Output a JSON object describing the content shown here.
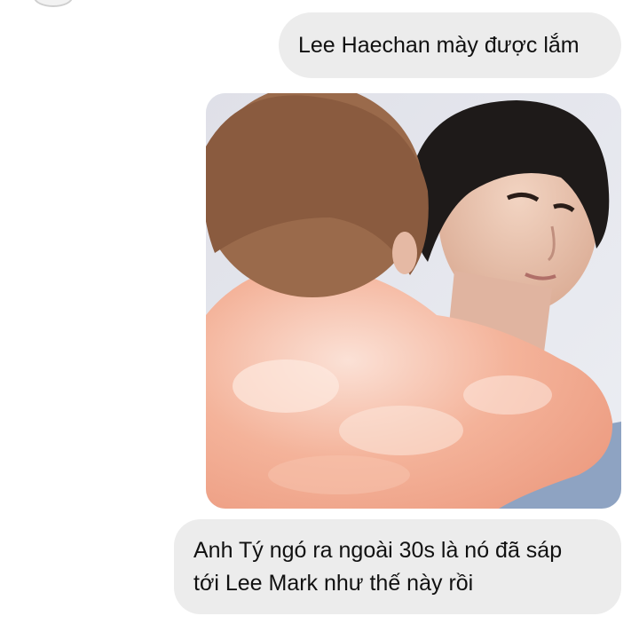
{
  "messages": [
    {
      "text": "Lee Haechan mày được lắm"
    },
    {
      "type": "image"
    },
    {
      "lines": [
        "Anh Tý ngó ra ngoài 30s là nó đã sáp",
        "tới Lee Mark như thế này rồi"
      ]
    }
  ],
  "colors": {
    "bubble_bg": "#ececec",
    "text": "#111111",
    "background": "#ffffff"
  },
  "icons": [
    "avatar"
  ]
}
